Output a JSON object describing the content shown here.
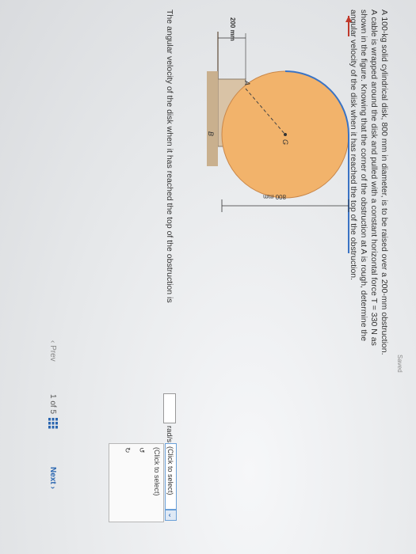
{
  "header": {
    "saved_label": "Saved"
  },
  "problem": {
    "text": "A 100-kg solid cylindrical disk, 800 mm in diameter, is to be raised over a 200-mm obstruction. A cable is wrapped around the disk and pulled with a constant horizontal force T = 330 N as shown in the figure. Knowing that the corner of the obstruction at A is rough, determine the angular velocity of the disk when it has reached the top of the obstruction."
  },
  "figure": {
    "force_label": "T",
    "center_label": "G",
    "corner_label": "A",
    "contact_label": "B",
    "diameter_label": "800 mm",
    "obstruction_label": "200 mm"
  },
  "question": {
    "prompt": "The angular velocity of the disk when it has reached the top of the obstruction is",
    "answer_value": "",
    "unit": "rad/s",
    "dropdown_selected": "(Click to select)",
    "dropdown_options": [
      "(Click to select)",
      "↺",
      "↻"
    ]
  },
  "navigation": {
    "prev_label": "Prev",
    "page_current": "1",
    "page_sep": "of",
    "page_total": "5",
    "next_label": "Next"
  }
}
